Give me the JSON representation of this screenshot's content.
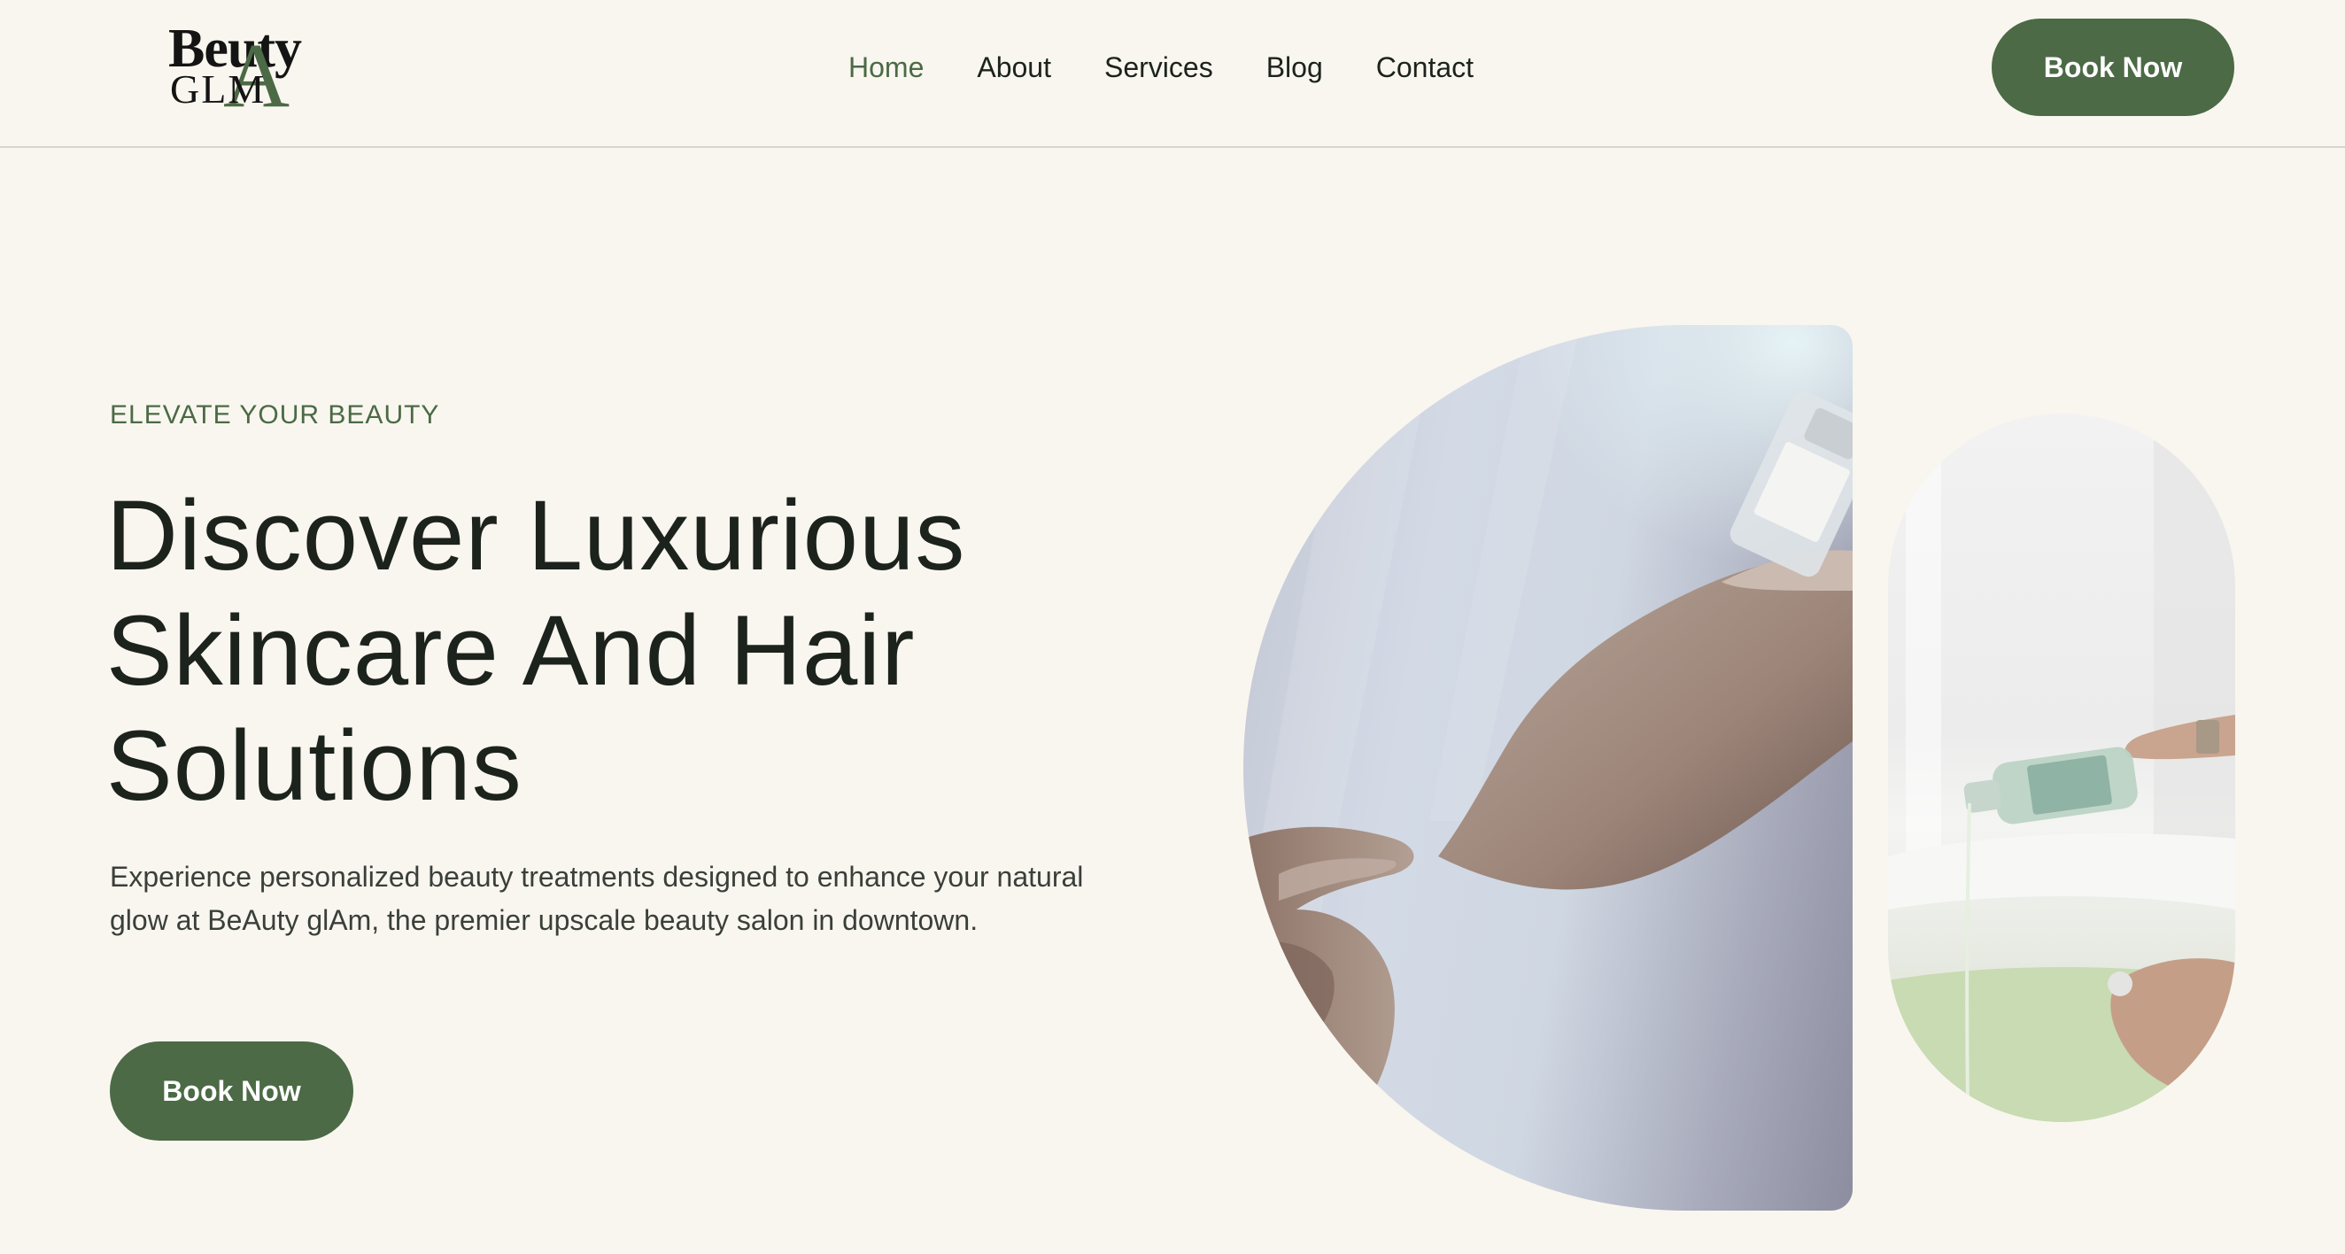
{
  "header": {
    "logo": {
      "line1": "Beuty",
      "line2": "GLM",
      "accent_letter": "A"
    },
    "nav": [
      {
        "label": "Home",
        "active": true
      },
      {
        "label": "About",
        "active": false
      },
      {
        "label": "Services",
        "active": false
      },
      {
        "label": "Blog",
        "active": false
      },
      {
        "label": "Contact",
        "active": false
      }
    ],
    "cta_label": "Book Now"
  },
  "hero": {
    "kicker": "ELEVATE YOUR BEAUTY",
    "title_lines": [
      "Discover Luxurious",
      "Skincare And Hair",
      "Solutions"
    ],
    "description": "Experience personalized beauty treatments designed to enhance your natural glow at BeAuty glAm, the premier upscale beauty salon in downtown.",
    "cta_label": "Book Now"
  },
  "colors": {
    "background": "#f9f6ef",
    "accent": "#4b6a45",
    "text": "#1c221c"
  },
  "images": {
    "main": "hand-applying-serum-photo",
    "side": "pouring-oil-into-bath-photo"
  }
}
